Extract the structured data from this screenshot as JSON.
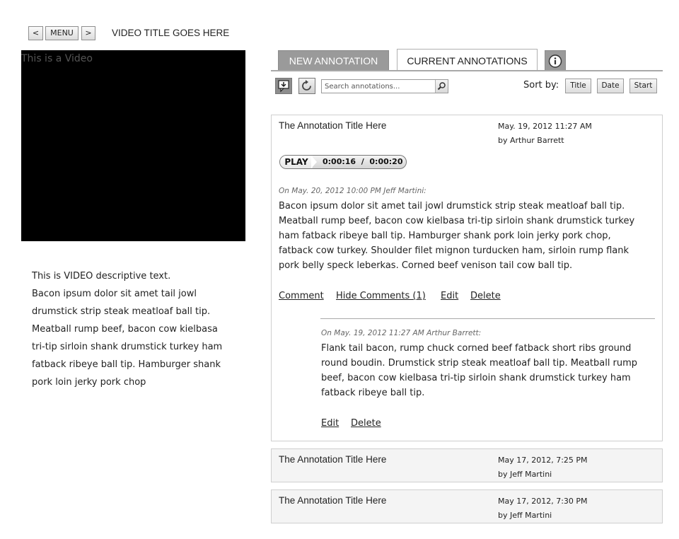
{
  "header": {
    "prev_label": "<",
    "menu_label": "MENU",
    "next_label": ">",
    "video_title": "VIDEO TITLE GOES HERE"
  },
  "video": {
    "placeholder": "This is a Video",
    "description": [
      "This is VIDEO descriptive text.",
      "Bacon ipsum dolor sit amet tail jowl",
      "drumstick strip steak meatloaf ball tip.",
      "Meatball rump beef, bacon cow kielbasa",
      "tri-tip sirloin shank drumstick turkey ham",
      "fatback ribeye ball tip. Hamburger shank",
      "pork loin jerky pork chop"
    ]
  },
  "tabs": {
    "new_annotation": "NEW ANNOTATION",
    "current_annotations": "CURRENT ANNOTATIONS",
    "info_icon": "info-icon"
  },
  "toolbar": {
    "add_icon": "add-annotation-icon",
    "refresh_icon": "refresh-icon",
    "search_placeholder": "Search annotations...",
    "search_icon": "magnifier-icon",
    "sort_label": "Sort by:",
    "sort_title": "Title",
    "sort_date": "Date",
    "sort_start": "Start"
  },
  "annotations": [
    {
      "title": "The Annotation Title Here",
      "date": "May. 19, 2012 11:27 AM",
      "author": "by Arthur Barrett",
      "play_label": "PLAY",
      "time": "0:00:16  /  0:00:20",
      "comment_meta": "On May. 20, 2012 10:00 PM Jeff Martini:",
      "comment_lines": [
        "Bacon ipsum dolor sit amet tail jowl drumstick strip steak meatloaf ball tip.",
        "Meatball rump beef, bacon cow kielbasa tri-tip sirloin shank drumstick turkey",
        "ham fatback ribeye ball tip. Hamburger shank pork loin jerky pork chop,",
        "fatback cow turkey. Shoulder filet mignon turducken ham, sirloin rump flank",
        "pork belly speck leberkas. Corned beef venison tail cow ball tip."
      ],
      "actions": {
        "comment": "Comment",
        "hide_comments": "Hide Comments (1)",
        "edit": "Edit",
        "delete": "Delete"
      },
      "reply": {
        "meta": "On May. 19, 2012 11:27 AM Arthur Barrett:",
        "lines": [
          "Flank tail bacon, rump chuck corned beef fatback short ribs ground",
          "round boudin. Drumstick strip steak meatloaf ball tip. Meatball rump",
          "beef, bacon cow kielbasa tri-tip sirloin shank drumstick turkey ham",
          "fatback ribeye ball tip."
        ],
        "actions": {
          "edit": "Edit",
          "delete": "Delete"
        }
      }
    },
    {
      "title": "The Annotation Title Here",
      "date": "May 17, 2012, 7:25 PM",
      "author": "by Jeff Martini"
    },
    {
      "title": "The Annotation Title Here",
      "date": "May 17, 2012, 7:30 PM",
      "author": "by Jeff Martini"
    }
  ]
}
